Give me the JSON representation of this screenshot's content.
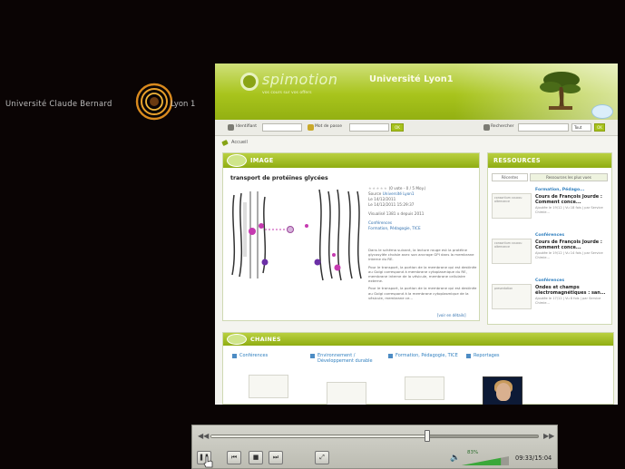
{
  "branding": {
    "left_text": "Université Claude Bernard",
    "right_text": "Lyon 1"
  },
  "site": {
    "logo_text": "spimotion",
    "logo_tagline": "vos cours sur vos offers",
    "university": "Université Lyon1",
    "toolbar": {
      "login_label": "Identifiant",
      "password_label": "Mot de passe",
      "ok_label": "OK",
      "search_label": "Rechercher",
      "search_scope": "Tout"
    },
    "breadcrumb": "Accueil",
    "image_panel": {
      "title": "IMAGE",
      "item_title": "transport de protéines glycées",
      "rating_text": "(0 vote - 0 / 5 Moy.)",
      "source_label": "Source",
      "source_value": "Université Lyon1",
      "date_line_1": "Le 14/12/2011",
      "date_line_2": "Le 14/12/2011 15:29:37",
      "views": "Visualisé 1381 x depuis 2011",
      "link_1": "Conférences",
      "link_2": "Formation, Pédagogie, TICE",
      "desc_p1": "Dans le schéma suivant, la lecture rouge est la protéine glycosylée choisie avec son ancrage GPI dans la membrane interne du RE.",
      "desc_p2": "Pour le transport, la portion de la membrane qui est destinée au Golgi correspond à membrane cytoplasmique du RE, membrane interne de la vésicule, membrane cellulaire externe.",
      "desc_p3": "Pour le transport, la portion de la membrane qui est destinée au Golgi correspond à la membrane cytoplasmique de la vésicule, membrane ce...",
      "more_link": "[voir en détails]"
    },
    "resources_panel": {
      "title": "RESSOURCES",
      "tabs": [
        "Récentes",
        "Ressources les plus vues"
      ],
      "items": [
        {
          "thumb": "consortium coucou alternance",
          "category": "Formation, Pédago...",
          "name": "Cours de François Jourde : Comment conce...",
          "meta": "Ajoutée le 19/12 | Vu 18 fois | par Service Chimie..."
        },
        {
          "thumb": "consortium coucou alternance",
          "category": "Conférences",
          "name": "Cours de François Jourde : Comment conce...",
          "meta": "Ajoutée le 19/12 | Vu 14 fois | par Service Chimie..."
        },
        {
          "thumb": "presentation",
          "category": "Conférences",
          "name": "Ondes et champs électromagnétiques : san...",
          "meta": "Ajoutée le 17/12 | Vu 8 fois | par Service Chimie..."
        }
      ]
    },
    "chaines_panel": {
      "title": "CHAINES",
      "columns": [
        {
          "name": "Conférences"
        },
        {
          "name": "Environnement / Développement durable"
        },
        {
          "name": "Formation, Pédagogie, TICE"
        },
        {
          "name": "Reportages"
        }
      ]
    }
  },
  "player": {
    "progress": 0.66,
    "volume_text": "83%",
    "volume": 0.83,
    "time": "09:33/15:04"
  }
}
